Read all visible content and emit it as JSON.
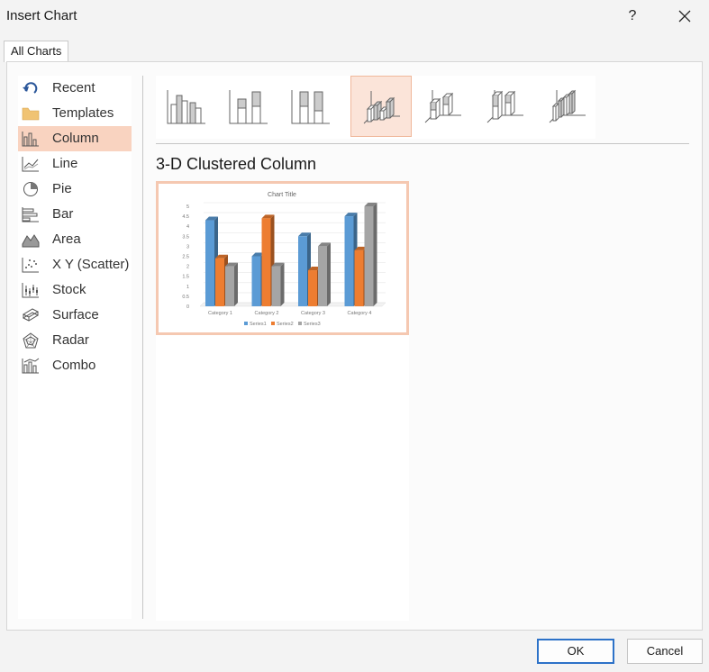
{
  "window": {
    "title": "Insert Chart",
    "help": "?",
    "close_icon": "close-icon"
  },
  "tabs": [
    {
      "label": "All Charts"
    }
  ],
  "sidebar": {
    "items": [
      {
        "label": "Recent",
        "icon": "recent-icon"
      },
      {
        "label": "Templates",
        "icon": "folder-icon"
      },
      {
        "label": "Column",
        "icon": "column-chart-icon",
        "selected": true
      },
      {
        "label": "Line",
        "icon": "line-chart-icon"
      },
      {
        "label": "Pie",
        "icon": "pie-chart-icon"
      },
      {
        "label": "Bar",
        "icon": "bar-chart-icon"
      },
      {
        "label": "Area",
        "icon": "area-chart-icon"
      },
      {
        "label": "X Y (Scatter)",
        "icon": "scatter-chart-icon"
      },
      {
        "label": "Stock",
        "icon": "stock-chart-icon"
      },
      {
        "label": "Surface",
        "icon": "surface-chart-icon"
      },
      {
        "label": "Radar",
        "icon": "radar-chart-icon"
      },
      {
        "label": "Combo",
        "icon": "combo-chart-icon"
      }
    ]
  },
  "subtypes": {
    "selected_index": 3,
    "items": [
      {
        "icon": "clustered-column-icon"
      },
      {
        "icon": "stacked-column-icon"
      },
      {
        "icon": "100-stacked-column-icon"
      },
      {
        "icon": "3d-clustered-column-icon"
      },
      {
        "icon": "3d-stacked-column-icon"
      },
      {
        "icon": "3d-100-stacked-column-icon"
      },
      {
        "icon": "3d-column-icon"
      }
    ],
    "selected_title": "3-D Clustered Column"
  },
  "chart_data": {
    "type": "bar",
    "title": "Chart Title",
    "categories": [
      "Category 1",
      "Category 2",
      "Category 3",
      "Category 4"
    ],
    "series": [
      {
        "name": "Series1",
        "values": [
          4.3,
          2.5,
          3.5,
          4.5
        ],
        "color": "#5b9bd5"
      },
      {
        "name": "Series2",
        "values": [
          2.4,
          4.4,
          1.8,
          2.8
        ],
        "color": "#ed7d31"
      },
      {
        "name": "Series3",
        "values": [
          2,
          2,
          3,
          5
        ],
        "color": "#a5a5a5"
      }
    ],
    "y_ticks": [
      "0",
      "0.5",
      "1",
      "1.5",
      "2",
      "2.5",
      "3",
      "3.5",
      "4",
      "4.5",
      "5"
    ],
    "ylim": [
      0,
      5
    ],
    "grid": true,
    "legend": "bottom"
  },
  "footer": {
    "ok_label": "OK",
    "cancel_label": "Cancel"
  }
}
